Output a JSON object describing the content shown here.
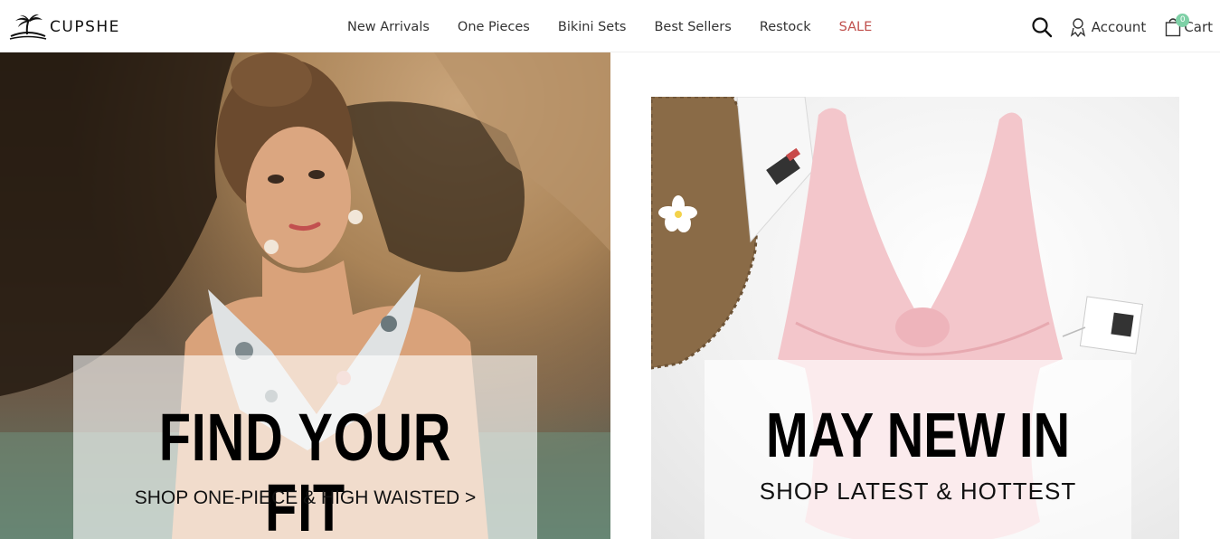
{
  "brand": {
    "logo_text": "CUPSHE",
    "logo_icon": "palm-tree-icon"
  },
  "nav": {
    "items": [
      {
        "label": "New Arrivals"
      },
      {
        "label": "One Pieces"
      },
      {
        "label": "Bikini Sets"
      },
      {
        "label": "Best Sellers"
      },
      {
        "label": "Restock"
      },
      {
        "label": "SALE",
        "color": "#c0504d"
      }
    ]
  },
  "tools": {
    "search_icon": "search-icon",
    "account_label": "Account",
    "account_icon": "user-icon",
    "cart_label": "Cart",
    "cart_icon": "shopping-bag-icon",
    "cart_count": "0",
    "cart_badge_color": "#7ed0a6"
  },
  "hero_left": {
    "headline": "FIND YOUR FIT",
    "subline": "SHOP ONE-PIECE & HIGH WAISTED >"
  },
  "hero_right": {
    "headline": "MAY NEW IN",
    "subline": "SHOP LATEST & HOTTEST"
  }
}
